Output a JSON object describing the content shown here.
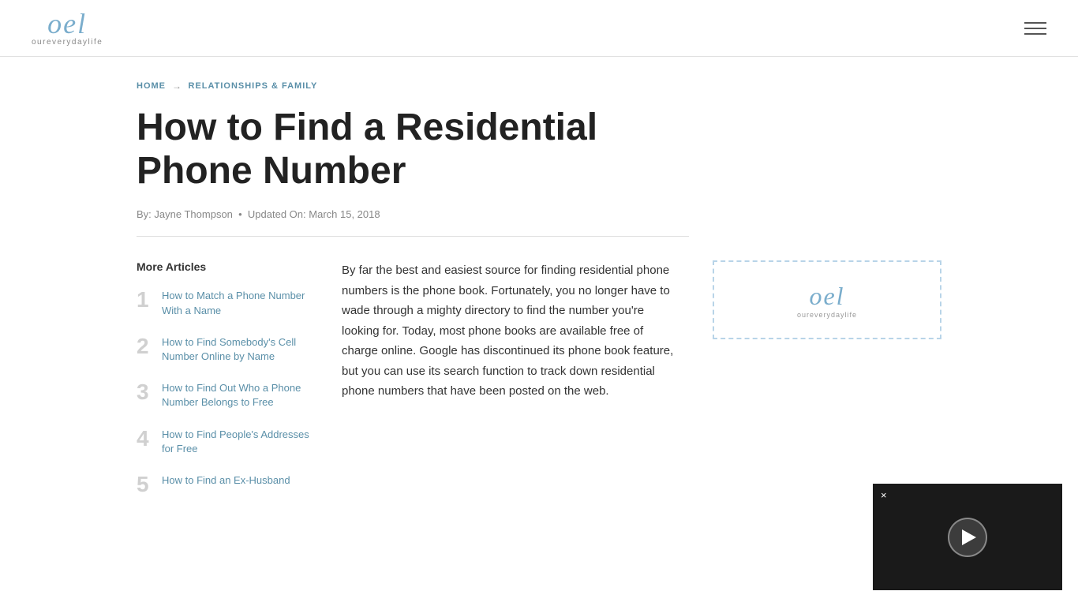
{
  "header": {
    "logo_text": "oel",
    "logo_subtext": "oureverydaylife",
    "menu_label": "Menu"
  },
  "breadcrumb": {
    "home": "HOME",
    "arrow": "→",
    "category": "RELATIONSHIPS & FAMILY"
  },
  "article": {
    "title": "How to Find a Residential Phone Number",
    "author_prefix": "By:",
    "author": "Jayne Thompson",
    "updated_prefix": "Updated On:",
    "updated_date": "March 15, 2018",
    "body": "By far the best and easiest source for finding residential phone numbers is the phone book. Fortunately, you no longer have to wade through a mighty directory to find the number you're looking for. Today, most phone books are available free of charge online. Google has discontinued its phone book feature, but you can use its search function to track down residential phone numbers that have been posted on the web."
  },
  "sidebar": {
    "title": "More Articles",
    "items": [
      {
        "number": "1",
        "label": "How to Match a Phone Number With a Name",
        "href": "#"
      },
      {
        "number": "2",
        "label": "How to Find Somebody's Cell Number Online by Name",
        "href": "#"
      },
      {
        "number": "3",
        "label": "How to Find Out Who a Phone Number Belongs to Free",
        "href": "#"
      },
      {
        "number": "4",
        "label": "How to Find People's Addresses for Free",
        "href": "#"
      },
      {
        "number": "5",
        "label": "How to Find an Ex-Husband",
        "href": "#"
      }
    ]
  },
  "ad": {
    "logo_text": "oel",
    "logo_subtext": "oureverydaylife"
  },
  "video": {
    "close_label": "×",
    "play_label": "Play"
  }
}
